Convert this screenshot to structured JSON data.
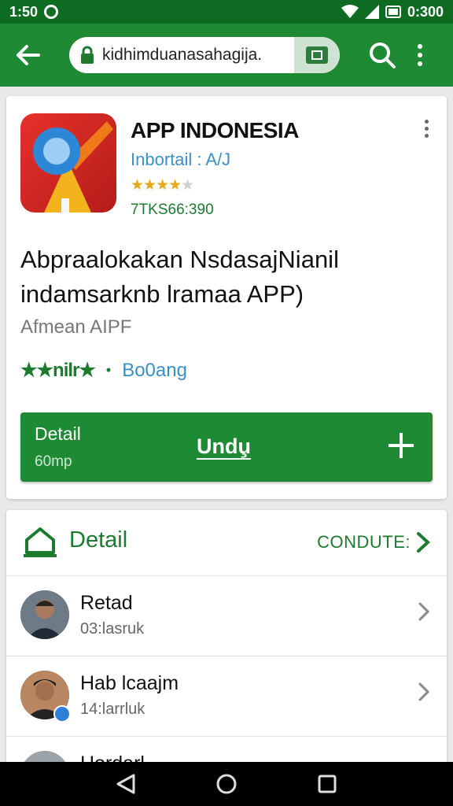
{
  "status_bar": {
    "time": "1:50",
    "clock_right": "0:300"
  },
  "app_bar": {
    "url": "kidhimduanasahagija."
  },
  "app": {
    "name": "APP INDONESIA",
    "developer": "Inbortail : A/J",
    "rating_stars": 4,
    "downloads": "7TKS66:390",
    "description": "Abpraalokakan NsdasajNianil indamsarknb lramaa APP)",
    "category": "Afmean AIPF",
    "rating_label": "★★nilr★",
    "rating_count": "Bo0ang",
    "install": {
      "detail": "Detail",
      "size": "60mp",
      "label": "Undu̧"
    }
  },
  "list": {
    "title": "Detail",
    "more": "CONDUTE:",
    "items": [
      {
        "name": "Retad",
        "time": "03:lasruk"
      },
      {
        "name": "Hab lcaajm",
        "time": "14:larrluk",
        "verified": true
      },
      {
        "name": "Hordarl",
        "time": ""
      }
    ]
  },
  "colors": {
    "primary": "#1e8a34",
    "status_bar": "#0d6b22",
    "accent_text": "#1d7a2f",
    "link": "#3a8fc4",
    "star": "#e6a91a"
  }
}
